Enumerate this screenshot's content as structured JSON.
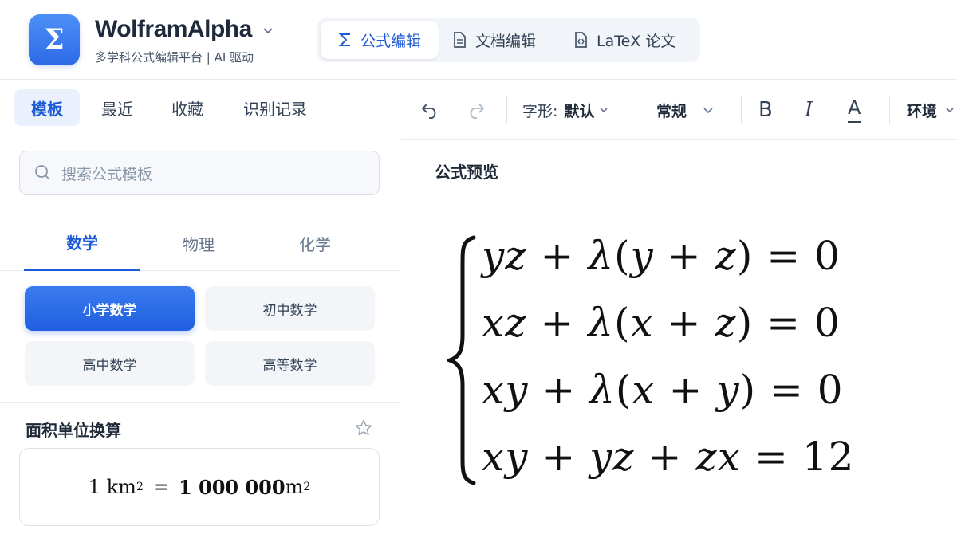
{
  "app": {
    "logo_glyph": "Σ",
    "name": "WolframAlpha",
    "subtitle": "多学科公式编辑平台 | AI 驱动",
    "accent": "#1d5ad6"
  },
  "mode_tabs": [
    {
      "label": "公式编辑",
      "icon": "sigma-icon",
      "active": true
    },
    {
      "label": "文档编辑",
      "icon": "document-icon",
      "active": false
    },
    {
      "label": "LaTeX 论文",
      "icon": "code-file-icon",
      "active": false
    }
  ],
  "left_tabs": [
    {
      "label": "模板",
      "active": true
    },
    {
      "label": "最近",
      "active": false
    },
    {
      "label": "收藏",
      "active": false
    },
    {
      "label": "识别记录",
      "active": false
    }
  ],
  "search": {
    "placeholder": "搜索公式模板"
  },
  "subjects": [
    {
      "label": "数学",
      "active": true
    },
    {
      "label": "物理",
      "active": false
    },
    {
      "label": "化学",
      "active": false
    }
  ],
  "grades": [
    {
      "label": "小学数学",
      "active": true
    },
    {
      "label": "初中数学",
      "active": false
    },
    {
      "label": "高中数学",
      "active": false
    },
    {
      "label": "高等数学",
      "active": false
    }
  ],
  "template_card": {
    "title": "面积单位换算",
    "formula_lhs": "1 km",
    "formula_eq": "=",
    "formula_rhs": "1 000 000",
    "formula_unit": " m",
    "exp": "2"
  },
  "toolbar": {
    "font_label": "字形:",
    "font_value": "默认",
    "style_value": "常规",
    "bold": "B",
    "italic": "I",
    "color": "A",
    "env_label": "环境"
  },
  "preview": {
    "label": "公式预览",
    "equations": [
      "yz + λ(y + z) = 0",
      "xz + λ(x + z) = 0",
      "xy + λ(x + y) = 0",
      "xy + yz + zx = 12"
    ]
  }
}
